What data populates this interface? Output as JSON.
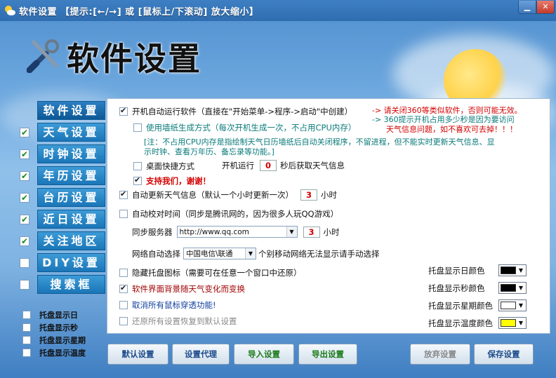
{
  "window": {
    "title": "软件设置 【提示:[←/→] 或 [鼠标上/下滚动] 放大缩小】",
    "min_glyph": "▁",
    "close_glyph": "✕"
  },
  "header": {
    "title": "软件设置",
    "icon": "tools-icon"
  },
  "sidebar": {
    "items": [
      {
        "label": "软件设置",
        "checked": null
      },
      {
        "label": "天气设置",
        "checked": true
      },
      {
        "label": "时钟设置",
        "checked": true
      },
      {
        "label": "年历设置",
        "checked": true
      },
      {
        "label": "台历设置",
        "checked": true
      },
      {
        "label": "近日设置",
        "checked": true
      },
      {
        "label": "关注地区",
        "checked": true
      },
      {
        "label": "DIY设置",
        "checked": false
      },
      {
        "label": "搜索框",
        "checked": false
      }
    ],
    "tray_options": [
      "托盘显示日",
      "托盘显示秒",
      "托盘显示星期",
      "托盘显示温度"
    ]
  },
  "panel": {
    "autostart": "开机自动运行软件（直接在\"开始菜单->程序->启动\"中创建）",
    "wallpaper": "使用墙纸生成方式（每次开机生成一次，不占用CPU内存）",
    "note_line1": "[注：不占用CPU内存是指绘制天气日历墙纸后自动关闭程序，不留进程，但不能实时更新天气信息、显",
    "note_line2": "示时钟、查看万年历、备忘录等功能。]",
    "warn1": "-> 请关闭360等类似软件，否则可能无效。",
    "warn2_line1": "-> 360提示开机占用多少秒是因为要访问",
    "warn2_line2": "天气信息问题，如不喜欢可去掉！！！",
    "desktop_shortcut": "桌面快捷方式",
    "boot_run_prefix": "开机运行",
    "boot_run_value": "0",
    "boot_run_suffix": "秒后获取天气信息",
    "support": "支持我们，谢谢！",
    "auto_update": "自动更新天气信息（默认一个小时更新一次）",
    "auto_update_value": "3",
    "auto_update_unit": "小时",
    "auto_sync": "自动校对时间（同步是腾讯网的，因为很多人玩QQ游戏）",
    "sync_server_label": "同步服务器",
    "sync_server_value": "http://www.qq.com",
    "sync_value": "3",
    "sync_unit": "小时",
    "network_label": "网络自动选择",
    "network_value": "中国电信\\联通",
    "network_note": "个别移动网络无法显示请手动选择",
    "hide_tray": "隐藏托盘图标（需要可在任意一个窗口中还原）",
    "bg_change": "软件界面背景随天气变化而变换",
    "cancel_mouse": "取消所有鼠标穿透功能!",
    "restore_default": "还原所有设置恢复到默认设置",
    "color_labels": [
      "托盘显示日颜色",
      "托盘显示秒颜色",
      "托盘显示星期颜色",
      "托盘显示温度颜色"
    ],
    "color_values": [
      "#000000",
      "#000000",
      "#ffffff",
      "#ffff00"
    ]
  },
  "buttons": {
    "default": "默认设置",
    "proxy": "设置代理",
    "import": "导入设置",
    "export": "导出设置",
    "discard": "放弃设置",
    "save": "保存设置"
  }
}
